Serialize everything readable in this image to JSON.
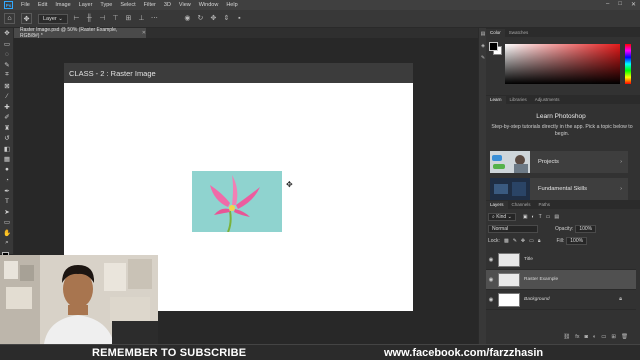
{
  "menubar": {
    "logo": "Ps",
    "items": [
      "File",
      "Edit",
      "Image",
      "Layer",
      "Type",
      "Select",
      "Filter",
      "3D",
      "View",
      "Window",
      "Help"
    ],
    "window_controls": [
      "–",
      "□",
      "✕"
    ]
  },
  "options_bar": {
    "tool_icon": "move-icon",
    "auto_select_target": "Layer"
  },
  "toolbar": {
    "tools": [
      "move-icon",
      "artboard-icon",
      "lasso-icon",
      "quick-select-icon",
      "crop-icon",
      "frame-icon",
      "eyedropper-icon",
      "spot-healing-icon",
      "brush-icon",
      "clone-stamp-icon",
      "history-brush-icon",
      "eraser-icon",
      "gradient-icon",
      "blur-icon",
      "dodge-icon",
      "pen-icon",
      "type-icon",
      "path-select-icon",
      "rectangle-icon",
      "hand-icon",
      "zoom-icon"
    ],
    "foreground_color": "#000000",
    "background_color": "#ffffff"
  },
  "document": {
    "tab_title": "Raster Image.psd @ 50% (Raster Example, RGB/8#) *",
    "artboard_title": "CLASS - 2 : Raster Image",
    "canvas_color": "#ffffff"
  },
  "color_panel": {
    "tabs": [
      "Color",
      "Swatches"
    ],
    "active_tab": "Color"
  },
  "learn_panel": {
    "tabs": [
      "Learn",
      "Libraries",
      "Adjustments"
    ],
    "title": "Learn Photoshop",
    "description": "Step-by-step tutorials directly in the app. Pick a topic below to begin.",
    "cards": [
      "Projects",
      "Fundamental Skills"
    ]
  },
  "layers_panel": {
    "tabs": [
      "Layers",
      "Channels",
      "Paths"
    ],
    "filter_kind": "Kind",
    "blend_mode": "Normal",
    "opacity_label": "Opacity:",
    "opacity_value": "100%",
    "lock_label": "Lock:",
    "fill_label": "Fill:",
    "fill_value": "100%",
    "layers": [
      {
        "name": "Title",
        "visible": true,
        "selected": false
      },
      {
        "name": "Raster Example",
        "visible": true,
        "selected": true
      },
      {
        "name": "Background",
        "visible": true,
        "selected": false,
        "locked": true
      }
    ]
  },
  "overlay": {
    "subscribe": "REMEMBER TO SUBSCRIBE",
    "facebook": "www.facebook.com/farzzhasin"
  }
}
